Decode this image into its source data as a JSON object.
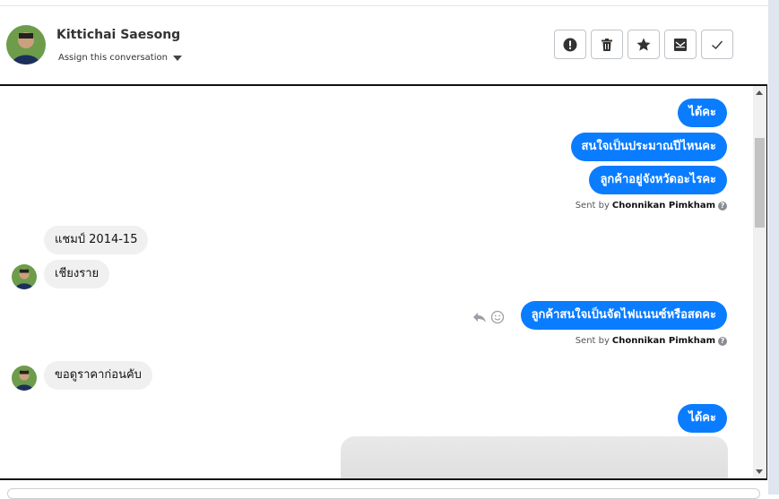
{
  "header": {
    "contact_name": "Kittichai Saesong",
    "assign_label": "Assign this conversation",
    "actions": [
      {
        "name": "mark-spam",
        "icon": "alert-icon"
      },
      {
        "name": "delete",
        "icon": "trash-icon"
      },
      {
        "name": "star",
        "icon": "star-icon"
      },
      {
        "name": "mark-unread",
        "icon": "envelope-icon"
      },
      {
        "name": "mark-done",
        "icon": "check-icon"
      }
    ]
  },
  "messages": [
    {
      "direction": "out",
      "text": "ได้คะ"
    },
    {
      "direction": "out",
      "text": "สนใจเป็นประมาณปีไหนคะ"
    },
    {
      "direction": "out",
      "text": "ลูกค้าอยู่จังหวัดอะไรคะ"
    },
    {
      "direction": "in",
      "text": "แชมป์ 2014-15"
    },
    {
      "direction": "in",
      "text": "เชียงราย"
    },
    {
      "direction": "out",
      "text": "ลูกค้าสนใจเป็นจัดไฟแนนซ์หรือสดคะ"
    },
    {
      "direction": "in",
      "text": "ขอดูราคาก่อนคับ"
    },
    {
      "direction": "out",
      "text": "ได้คะ"
    }
  ],
  "sent_by": {
    "prefix": "Sent by",
    "agent_name": "Chonnikan Pimkham"
  },
  "colors": {
    "outgoing_bubble": "#0a7cff",
    "incoming_bubble": "#f0f0f0"
  }
}
